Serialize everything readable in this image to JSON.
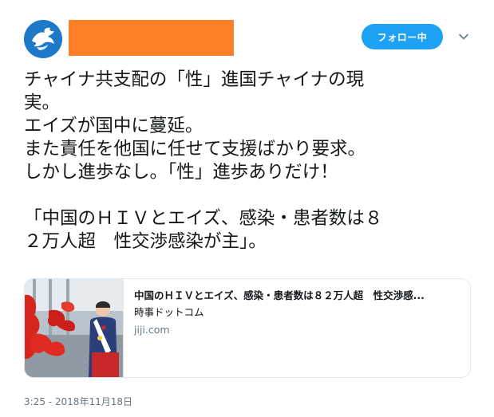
{
  "header": {
    "follow_label": "フォロー中"
  },
  "tweet": {
    "lines": [
      "チャイナ共支配の「性」進国チャイナの現",
      "実。",
      "エイズが国中に蔓延。",
      "また責任を他国に任せて支援ばかり要求。",
      "しかし進歩なし。「性」進歩ありだけ！",
      "",
      "「中国のＨＩＶとエイズ、感染・患者数は８",
      "２万人超　性交渉感染が主」。"
    ],
    "timestamp": "3:25 - 2018年11月18日"
  },
  "card": {
    "title": "中国のＨＩＶとエイズ、感染・患者数は８２万人超　性交渉感...",
    "description": "時事ドットコム",
    "domain": "jiji.com"
  },
  "icons": {
    "avatar": "bird-logo-avatar",
    "menu": "chevron-down-icon"
  },
  "colors": {
    "accent": "#1da1f2",
    "redaction": "#ff7f27",
    "avatar_bg": "#1e7ac9",
    "muted_text": "#657786"
  }
}
